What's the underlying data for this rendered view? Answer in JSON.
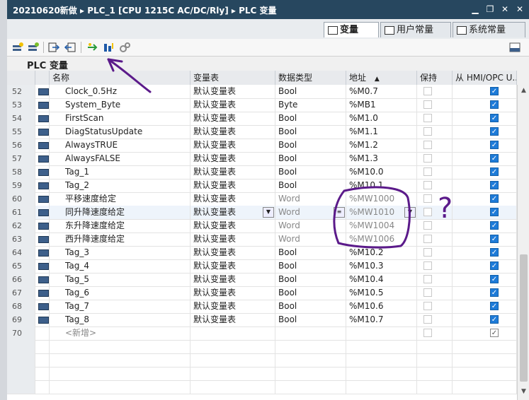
{
  "window": {
    "breadcrumb": [
      "20210620新做",
      "PLC_1 [CPU 1215C AC/DC/Rly]",
      "PLC 变量"
    ],
    "separator": "▸",
    "controls": [
      "▁",
      "❐",
      "✕",
      "✕"
    ]
  },
  "tabs": [
    {
      "label": "变量",
      "active": true
    },
    {
      "label": "用户常量",
      "active": false
    },
    {
      "label": "系统常量",
      "active": false
    }
  ],
  "section_title": "PLC 变量",
  "columns": {
    "name": "名称",
    "table": "变量表",
    "datatype": "数据类型",
    "address": "地址",
    "sort_indicator": "▲",
    "retain": "保持",
    "hmi": "从 HMI/OPC U..."
  },
  "rows": [
    {
      "num": "52",
      "name": "Clock_0.5Hz",
      "table": "默认变量表",
      "datatype": "Bool",
      "address": "%M0.7",
      "retain": false,
      "retain_enabled": false,
      "hmi": true
    },
    {
      "num": "53",
      "name": "System_Byte",
      "table": "默认变量表",
      "datatype": "Byte",
      "address": "%MB1",
      "retain": false,
      "retain_enabled": false,
      "hmi": true
    },
    {
      "num": "54",
      "name": "FirstScan",
      "table": "默认变量表",
      "datatype": "Bool",
      "address": "%M1.0",
      "retain": false,
      "retain_enabled": false,
      "hmi": true
    },
    {
      "num": "55",
      "name": "DiagStatusUpdate",
      "table": "默认变量表",
      "datatype": "Bool",
      "address": "%M1.1",
      "retain": false,
      "retain_enabled": false,
      "hmi": true
    },
    {
      "num": "56",
      "name": "AlwaysTRUE",
      "table": "默认变量表",
      "datatype": "Bool",
      "address": "%M1.2",
      "retain": false,
      "retain_enabled": false,
      "hmi": true
    },
    {
      "num": "57",
      "name": "AlwaysFALSE",
      "table": "默认变量表",
      "datatype": "Bool",
      "address": "%M1.3",
      "retain": false,
      "retain_enabled": false,
      "hmi": true
    },
    {
      "num": "58",
      "name": "Tag_1",
      "table": "默认变量表",
      "datatype": "Bool",
      "address": "%M10.0",
      "retain": false,
      "retain_enabled": false,
      "hmi": true
    },
    {
      "num": "59",
      "name": "Tag_2",
      "table": "默认变量表",
      "datatype": "Bool",
      "address": "%M10.1",
      "retain": false,
      "retain_enabled": false,
      "hmi": true
    },
    {
      "num": "60",
      "name": "平移速度给定",
      "table": "默认变量表",
      "datatype": "Word",
      "address": "%MW1000",
      "retain": false,
      "retain_enabled": false,
      "hmi": true
    },
    {
      "num": "61",
      "name": "同升降速度给定",
      "table": "默认变量表",
      "datatype": "Word",
      "address": "%MW1010",
      "retain": false,
      "retain_enabled": false,
      "hmi": true,
      "selected": true
    },
    {
      "num": "62",
      "name": "东升降速度给定",
      "table": "默认变量表",
      "datatype": "Word",
      "address": "%MW1004",
      "retain": false,
      "retain_enabled": false,
      "hmi": true
    },
    {
      "num": "63",
      "name": "西升降速度给定",
      "table": "默认变量表",
      "datatype": "Word",
      "address": "%MW1006",
      "retain": false,
      "retain_enabled": false,
      "hmi": true
    },
    {
      "num": "64",
      "name": "Tag_3",
      "table": "默认变量表",
      "datatype": "Bool",
      "address": "%M10.2",
      "retain": false,
      "retain_enabled": false,
      "hmi": true
    },
    {
      "num": "65",
      "name": "Tag_4",
      "table": "默认变量表",
      "datatype": "Bool",
      "address": "%M10.3",
      "retain": false,
      "retain_enabled": false,
      "hmi": true
    },
    {
      "num": "66",
      "name": "Tag_5",
      "table": "默认变量表",
      "datatype": "Bool",
      "address": "%M10.4",
      "retain": false,
      "retain_enabled": false,
      "hmi": true
    },
    {
      "num": "67",
      "name": "Tag_6",
      "table": "默认变量表",
      "datatype": "Bool",
      "address": "%M10.5",
      "retain": false,
      "retain_enabled": false,
      "hmi": true
    },
    {
      "num": "68",
      "name": "Tag_7",
      "table": "默认变量表",
      "datatype": "Bool",
      "address": "%M10.6",
      "retain": false,
      "retain_enabled": false,
      "hmi": true
    },
    {
      "num": "69",
      "name": "Tag_8",
      "table": "默认变量表",
      "datatype": "Bool",
      "address": "%M10.7",
      "retain": false,
      "retain_enabled": false,
      "hmi": true
    }
  ],
  "new_row": {
    "num": "70",
    "label": "<新增>"
  },
  "annotations": {
    "question_mark": "?"
  },
  "colors": {
    "titlebar": "#27475f",
    "checkbox_on": "#1e7bd8",
    "annotation_pen": "#5b1a8a"
  }
}
